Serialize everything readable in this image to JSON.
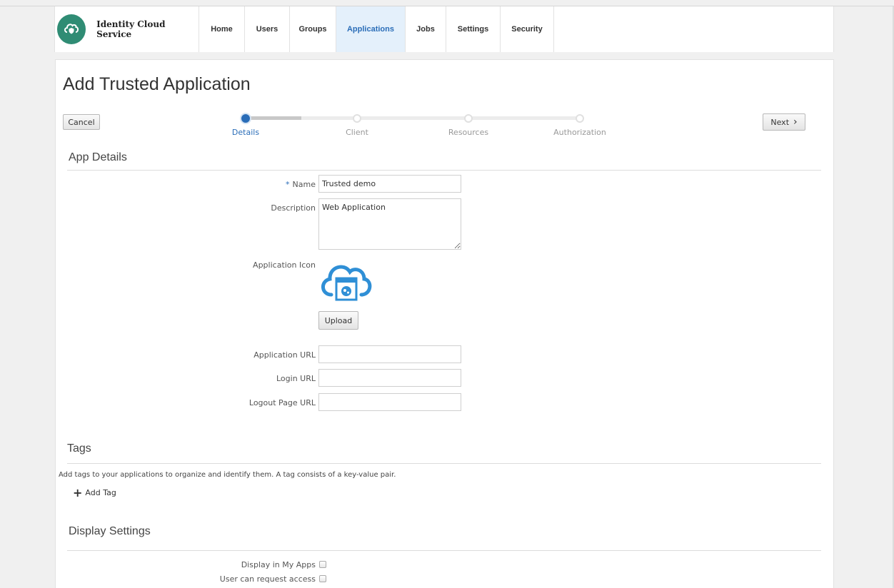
{
  "header": {
    "brand": "Identity Cloud Service",
    "nav": [
      "Home",
      "Users",
      "Groups",
      "Applications",
      "Jobs",
      "Settings",
      "Security"
    ],
    "active_nav": "Applications"
  },
  "page": {
    "title": "Add Trusted Application",
    "cancel_label": "Cancel",
    "next_label": "Next"
  },
  "steps": [
    "Details",
    "Client",
    "Resources",
    "Authorization"
  ],
  "active_step": "Details",
  "app_details": {
    "section_title": "App Details",
    "name_label": "Name",
    "name_value": "Trusted demo",
    "description_label": "Description",
    "description_value": "Web Application",
    "icon_label": "Application Icon",
    "upload_label": "Upload",
    "app_url_label": "Application URL",
    "app_url_value": "",
    "login_url_label": "Login URL",
    "login_url_value": "",
    "logout_url_label": "Logout Page URL",
    "logout_url_value": ""
  },
  "tags": {
    "section_title": "Tags",
    "description": "Add tags to your applications to organize and identify them. A tag consists of a key-value pair.",
    "add_label": "Add Tag"
  },
  "display_settings": {
    "section_title": "Display Settings",
    "display_in_my_apps_label": "Display in My Apps",
    "display_in_my_apps_checked": false,
    "user_can_request_access_label": "User can request access",
    "user_can_request_access_checked": false
  },
  "colors": {
    "accent": "#2a6db8",
    "brand": "#2f8c74",
    "nav_active_bg": "#e4f0fb",
    "icon_blue": "#2f8fd6"
  }
}
